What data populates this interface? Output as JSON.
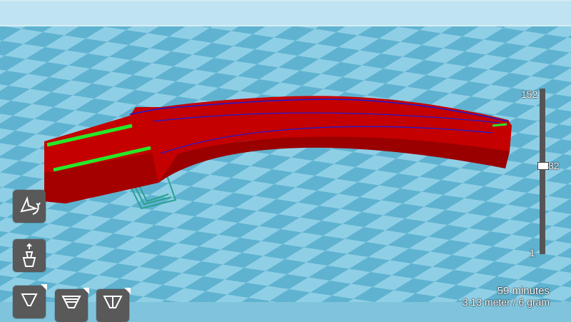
{
  "colors": {
    "sky": "#bfe3f0",
    "bed_light": "#8fcfe6",
    "bed_dark": "#5fb3d0",
    "model": "#c40000",
    "model_dark": "#8a0000",
    "infill": "#27e827",
    "outline": "#1b1bd8",
    "support": "#2aa090",
    "tool_bg": "#595959"
  },
  "tools": [
    {
      "name": "rotate-tool",
      "icon": "rotate-icon"
    },
    {
      "name": "scale-tool",
      "icon": "scale-icon"
    },
    {
      "name": "view-mode-normal",
      "icon": "view-normal-icon"
    },
    {
      "name": "view-mode-overhang",
      "icon": "view-overhang-icon"
    },
    {
      "name": "view-mode-layers",
      "icon": "view-layers-icon"
    }
  ],
  "layers": {
    "max": "152",
    "current": "82",
    "min": "1",
    "position_fraction": 0.54
  },
  "print_info": {
    "time": "59 minutes",
    "material": "3.13 meter / 6 gram"
  }
}
